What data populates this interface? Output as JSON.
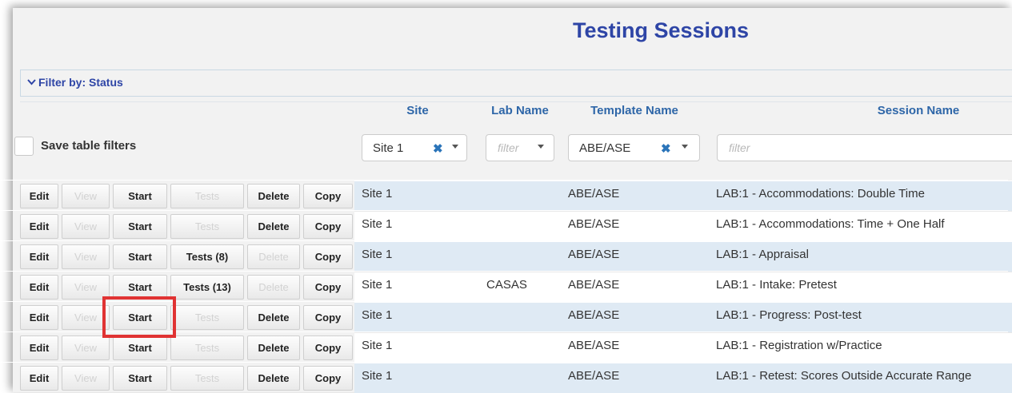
{
  "title": "Testing Sessions",
  "filter_bar": {
    "label": "Filter by: Status",
    "icon": "chevron-down-icon"
  },
  "columns": {
    "site": "Site",
    "lab_name": "Lab Name",
    "template_name": "Template Name",
    "session_name": "Session Name"
  },
  "save_filters": {
    "label": "Save table filters",
    "checked": false
  },
  "filters": {
    "site": {
      "value": "Site 1",
      "clear": "✖"
    },
    "lab_name": {
      "placeholder": "filter"
    },
    "template_name": {
      "value": "ABE/ASE",
      "clear": "✖"
    },
    "session_name": {
      "placeholder": "filter"
    }
  },
  "rows": [
    {
      "edit": "Edit",
      "view": "View",
      "start": "Start",
      "tests": "Tests",
      "delete": "Delete",
      "copy": "Copy",
      "tests_enabled": false,
      "delete_enabled": true,
      "site": "Site 1",
      "lab": "",
      "template": "ABE/ASE",
      "session": "LAB:1 - Accommodations: Double Time"
    },
    {
      "edit": "Edit",
      "view": "View",
      "start": "Start",
      "tests": "Tests",
      "delete": "Delete",
      "copy": "Copy",
      "tests_enabled": false,
      "delete_enabled": true,
      "site": "Site 1",
      "lab": "",
      "template": "ABE/ASE",
      "session": "LAB:1 - Accommodations: Time + One Half"
    },
    {
      "edit": "Edit",
      "view": "View",
      "start": "Start",
      "tests": "Tests (8)",
      "delete": "Delete",
      "copy": "Copy",
      "tests_enabled": true,
      "delete_enabled": false,
      "site": "Site 1",
      "lab": "",
      "template": "ABE/ASE",
      "session": "LAB:1 - Appraisal"
    },
    {
      "edit": "Edit",
      "view": "View",
      "start": "Start",
      "tests": "Tests (13)",
      "delete": "Delete",
      "copy": "Copy",
      "tests_enabled": true,
      "delete_enabled": false,
      "site": "Site 1",
      "lab": "CASAS",
      "template": "ABE/ASE",
      "session": "LAB:1 - Intake: Pretest"
    },
    {
      "edit": "Edit",
      "view": "View",
      "start": "Start",
      "tests": "Tests",
      "delete": "Delete",
      "copy": "Copy",
      "tests_enabled": false,
      "delete_enabled": true,
      "site": "Site 1",
      "lab": "",
      "template": "ABE/ASE",
      "session": "LAB:1 - Progress: Post-test"
    },
    {
      "edit": "Edit",
      "view": "View",
      "start": "Start",
      "tests": "Tests",
      "delete": "Delete",
      "copy": "Copy",
      "tests_enabled": false,
      "delete_enabled": true,
      "site": "Site 1",
      "lab": "",
      "template": "ABE/ASE",
      "session": "LAB:1 - Registration w/Practice"
    },
    {
      "edit": "Edit",
      "view": "View",
      "start": "Start",
      "tests": "Tests",
      "delete": "Delete",
      "copy": "Copy",
      "tests_enabled": false,
      "delete_enabled": true,
      "site": "Site 1",
      "lab": "",
      "template": "ABE/ASE",
      "session": "LAB:1 - Retest: Scores Outside Accurate Range"
    }
  ],
  "colors": {
    "title": "#2e45a6",
    "header": "#2e66a8",
    "highlight": "#e03333",
    "row_blue": "#dfeaf4"
  }
}
